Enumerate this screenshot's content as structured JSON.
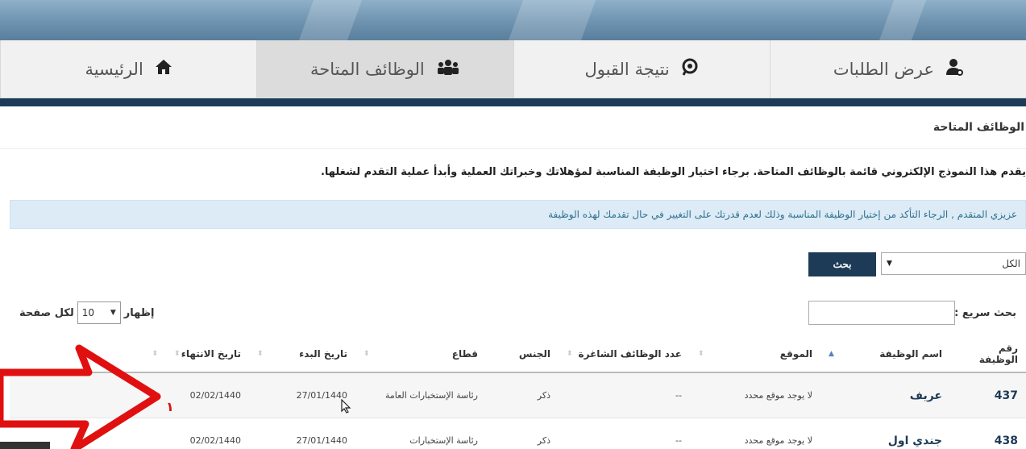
{
  "nav": {
    "items": [
      {
        "label": "الرئيسية",
        "icon": "home-icon",
        "active": false
      },
      {
        "label": "الوظائف المتاحة",
        "icon": "users-icon",
        "active": true
      },
      {
        "label": "نتيجة القبول",
        "icon": "search-icon",
        "active": false
      },
      {
        "label": "عرض الطلبات",
        "icon": "user-settings-icon",
        "active": false
      }
    ]
  },
  "page": {
    "title": "الوظائف المتاحة",
    "intro": "يقدم هذا النموذج الإلكتروني قائمة بالوظائف المتاحة. برجاء اختيار الوظيفة المناسبة لمؤهلاتك وخبراتك العملية وأبدأ عملية التقدم لشغلها.",
    "notice": "عزيزي المتقدم , الرجاء التأكد من إختيار الوظيفة المناسبة وذلك لعدم قدرتك على التغيير في حال تقدمك لهذه الوظيفة"
  },
  "filter": {
    "selected": "الكل",
    "search_label": "بحث"
  },
  "table_controls": {
    "quick_search_label": "بحث سريع :",
    "show_label": "إظهار",
    "page_size": "10",
    "per_page_label": "لكل صفحة"
  },
  "table": {
    "headers": [
      "رقم الوظيفة",
      "اسم الوظيفة",
      "الموقع",
      "عدد الوظائف الشاغرة",
      "الجنس",
      "قطاع",
      "تاريخ البدء",
      "تاريخ الانتهاء"
    ],
    "rows": [
      {
        "id": "437",
        "name": "عريف",
        "location": "لا يوجد موقع محدد",
        "vacancies": "--",
        "gender": "ذكر",
        "sector": "رئاسة الإستخبارات العامة",
        "start": "27/01/1440",
        "end": "02/02/1440"
      },
      {
        "id": "438",
        "name": "جندي اول",
        "location": "لا يوجد موقع محدد",
        "vacancies": "--",
        "gender": "ذكر",
        "sector": "رئاسة الإستخبارات",
        "start": "27/01/1440",
        "end": "02/02/1440"
      }
    ]
  },
  "annotation": {
    "mark": "١",
    "color": "#e01010"
  },
  "colors": {
    "primary": "#1d3b57",
    "notice_bg": "#dcebf6"
  }
}
